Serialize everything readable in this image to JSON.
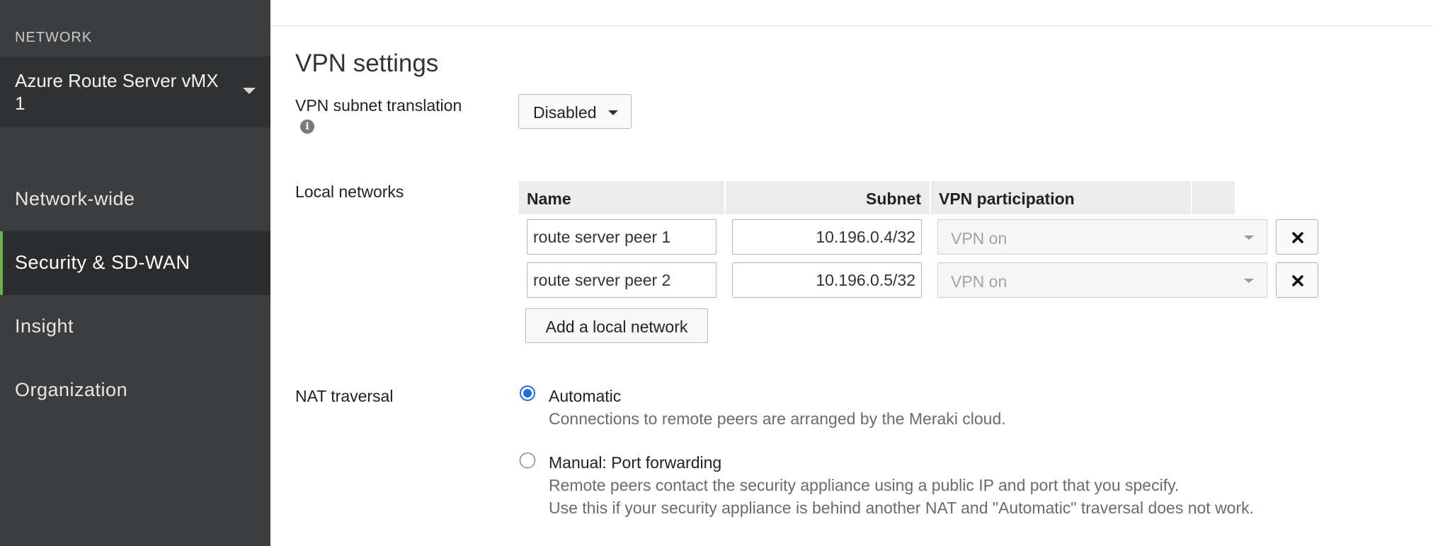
{
  "sidebar": {
    "caption": "NETWORK",
    "network_name": "Azure Route Server vMX 1",
    "items": [
      {
        "label": "Network-wide"
      },
      {
        "label": "Security & SD-WAN"
      },
      {
        "label": "Insight"
      },
      {
        "label": "Organization"
      }
    ],
    "active_item": "Security & SD-WAN",
    "colors": {
      "background": "#3b3d3e",
      "active_background": "#2b2c2d",
      "active_accent": "#67b346"
    }
  },
  "main": {
    "section_title": "VPN settings",
    "subnet_translation": {
      "label": "VPN subnet translation",
      "info_icon": "info-icon",
      "value": "Disabled"
    },
    "local_networks": {
      "label": "Local networks",
      "columns": [
        "Name",
        "Subnet",
        "VPN participation"
      ],
      "rows": [
        {
          "name": "route server peer 1",
          "subnet": "10.196.0.4/32",
          "participation": "VPN on"
        },
        {
          "name": "route server peer 2",
          "subnet": "10.196.0.5/32",
          "participation": "VPN on"
        }
      ],
      "delete_icon": "close-icon",
      "add_button": "Add a local network"
    },
    "nat_traversal": {
      "label": "NAT traversal",
      "options": [
        {
          "label": "Automatic",
          "checked": true,
          "description": [
            "Connections to remote peers are arranged by the Meraki cloud."
          ]
        },
        {
          "label": "Manual: Port forwarding",
          "checked": false,
          "description": [
            "Remote peers contact the security appliance using a public IP and port that you specify.",
            "Use this if your security appliance is behind another NAT and \"Automatic\" traversal does not work."
          ]
        }
      ]
    },
    "colors": {
      "radio_selected": "#1f6fe0",
      "table_header": "#ececec"
    }
  }
}
